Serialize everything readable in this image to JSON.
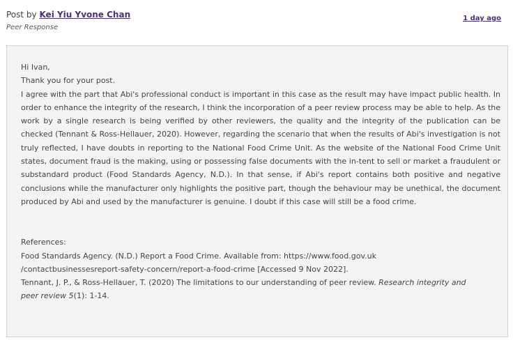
{
  "header": {
    "post_by_prefix": "Post by",
    "author": "Kei Yiu Yvone Chan",
    "post_type": "Peer Response",
    "timestamp": "1 day ago"
  },
  "post": {
    "greeting": "Hi Ivan,",
    "thanks": "Thank you for your post.",
    "body": "I agree with the part that Abi's professional conduct is important in this case as the result may have impact public health. In order to enhance the integrity of the research, I think the incorporation of a peer review process may be able to help. As the work by a single research is being verified by other reviewers, the quality and the integrity of the publication can be checked (Tennant & Ross-Hellauer, 2020). However, regarding the scenario that when the results of Abi's investigation is not truly reflected, I have doubts in reporting to the National Food Crime Unit. As the website of the National Food Crime Unit states, document fraud is the making, using or possessing false documents with the in-tent to sell or market a fraudulent or substandard product (Food Standards Agency, N.D.). In that sense, if Abi's report contains both positive and negative conclusions while the manufacturer only highlights the positive part, though the behaviour may be unethical, the document produced by Abi and used by the manufacturer is genuine. I doubt if this case will still be a food crime.",
    "references_heading": "References:",
    "ref1_line1": "Food Standards Agency. (N.D.) Report a Food Crime. Available from: https://www.food.gov.uk",
    "ref1_line2": "/contactbusinessesreport-safety-concern/report-a-food-crime [Accessed 9 Nov 2022].",
    "ref2_prefix": "Tennant, J. P., & Ross-Hellauer, T. (2020) The limitations to our understanding of peer review.",
    "ref2_journal_a": "Research integrity and",
    "ref2_journal_b": "peer review 5",
    "ref2_suffix": "(1): 1-14."
  }
}
